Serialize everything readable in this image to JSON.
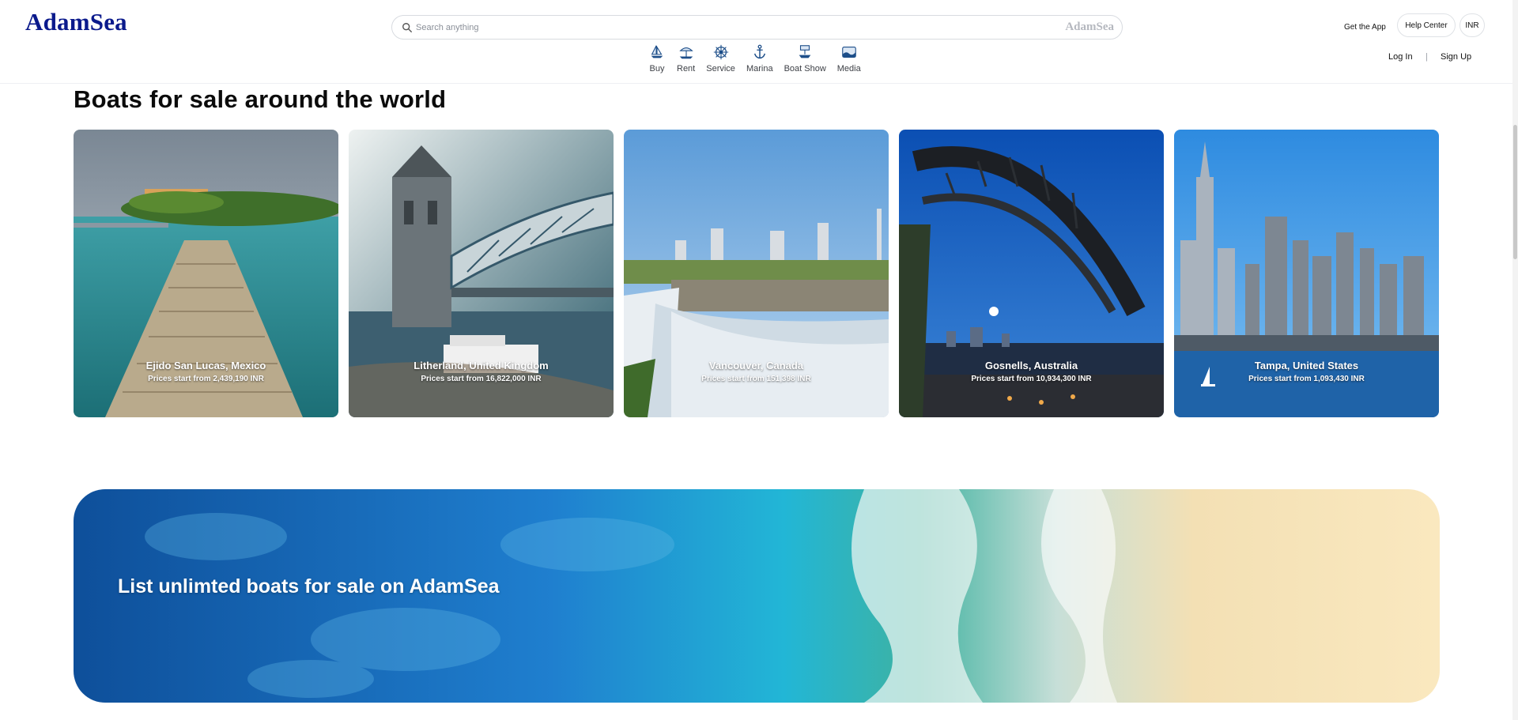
{
  "header": {
    "logo": "AdamSea",
    "search": {
      "placeholder": "Search anything",
      "brand": "AdamSea"
    },
    "nav": [
      {
        "label": "Buy",
        "icon": "sailboat-icon"
      },
      {
        "label": "Rent",
        "icon": "beach-umbrella-icon"
      },
      {
        "label": "Service",
        "icon": "ship-wheel-icon"
      },
      {
        "label": "Marina",
        "icon": "anchor-icon"
      },
      {
        "label": "Boat Show",
        "icon": "boat-show-icon"
      },
      {
        "label": "Media",
        "icon": "media-icon"
      }
    ],
    "get_app": "Get the App",
    "help_center": "Help Center",
    "currency": "INR",
    "login": "Log In",
    "separator": "|",
    "signup": "Sign Up"
  },
  "section": {
    "title": "Boats for sale around the world"
  },
  "cards": [
    {
      "city": "Ejido San Lucas, Mexico",
      "price": "Prices start from 2,439,190 INR"
    },
    {
      "city": "Litherland, United Kingdom",
      "price": "Prices start from 16,822,000 INR"
    },
    {
      "city": "Vancouver, Canada",
      "price": "Prices start from 151,398 INR"
    },
    {
      "city": "Gosnells, Australia",
      "price": "Prices start from 10,934,300 INR"
    },
    {
      "city": "Tampa, United States",
      "price": "Prices start from 1,093,430 INR"
    }
  ],
  "banner": {
    "text": "List unlimted boats for sale on AdamSea"
  },
  "colors": {
    "brand": "#0b1a8c",
    "nav_icon": "#1d4e89"
  }
}
